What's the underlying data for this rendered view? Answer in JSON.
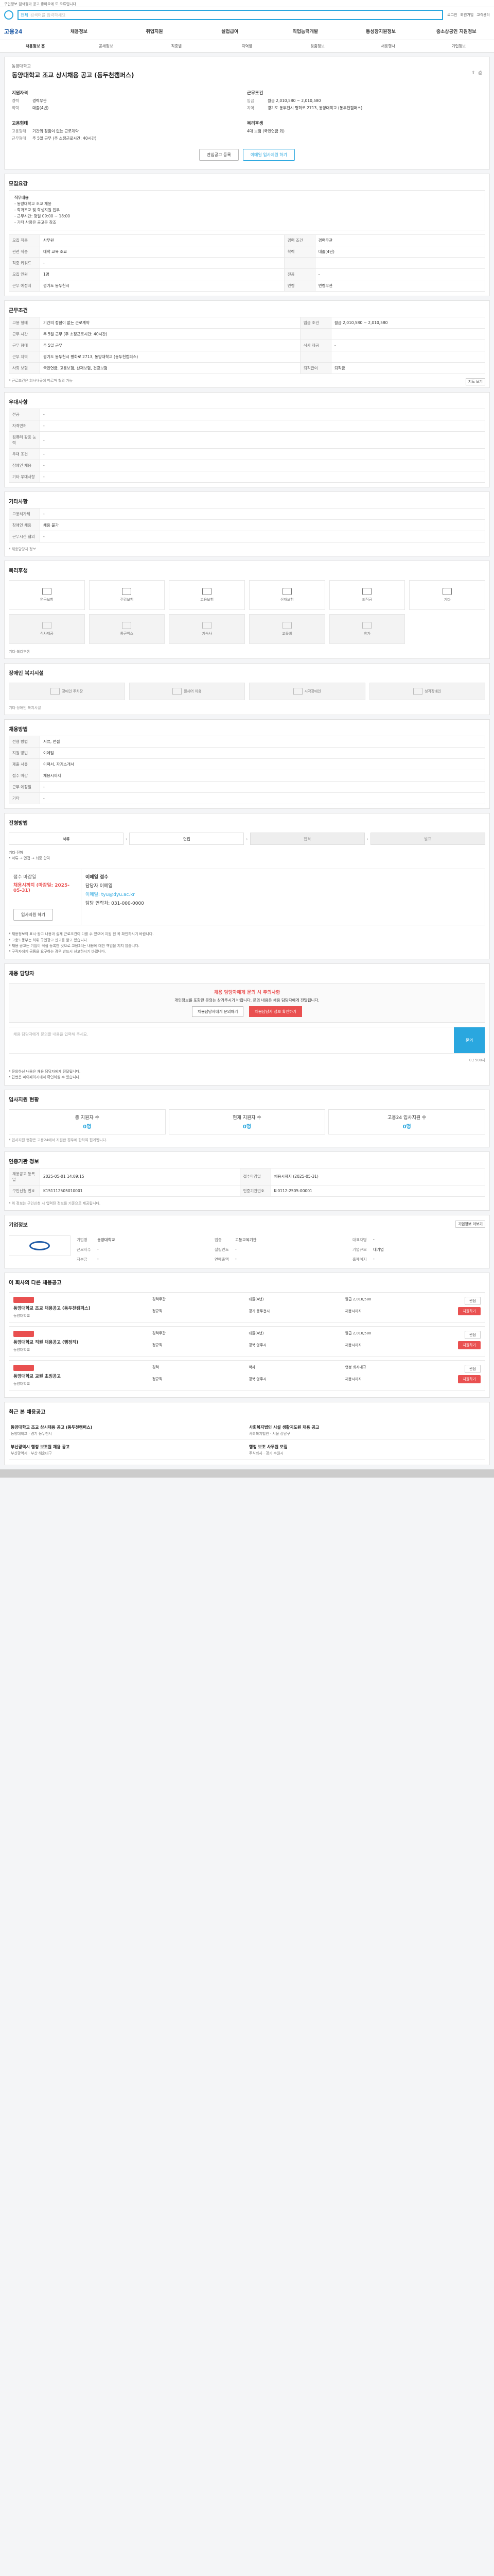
{
  "top_note": "구인정보 검색결과 공고 좋아요에 도 오류입니다",
  "search": {
    "scope": "전체",
    "placeholder": "검색어를 입력하세요"
  },
  "top_links": [
    "로그인",
    "회원가입",
    "고객센터"
  ],
  "brand": "고용24",
  "gnb": [
    "채용정보",
    "취업지원",
    "실업급여",
    "직업능력개발",
    "통성장지원정보",
    "중소상공인 지원정보"
  ],
  "lnb": [
    "채용정보 홈",
    "공채정보",
    "직종별",
    "지역별",
    "맞춤정보",
    "채용행사",
    "기업정보"
  ],
  "header": {
    "org": "동양대학교",
    "title": "동양대학교 조교 상시채용 공고 (동두천캠퍼스)",
    "icons": [
      "share-icon",
      "print-icon"
    ]
  },
  "summary": {
    "left_h": "지원자격",
    "left": [
      [
        "경력",
        "경력무관"
      ],
      [
        "학력",
        "대졸(4년)"
      ]
    ],
    "right_h": "근무조건",
    "right": [
      [
        "임금",
        "월급 2,010,580 ~ 2,010,580"
      ],
      [
        "지역",
        "경기도 동두천시 평화로 2713, 동양대학교 (동두천캠퍼스)"
      ]
    ],
    "left_h2": "고용형태",
    "left2": [
      [
        "고용형태",
        "기간의 정함이 없는 근로계약"
      ],
      [
        "근무형태",
        "주 5일 근무 (주 소정근로시간: 40시간)"
      ]
    ],
    "right_h2": "복리후생",
    "right2": [
      [
        "",
        "4대 보험 (국민연금 외)"
      ]
    ]
  },
  "btns": {
    "save": "관심공고 등록",
    "apply": "이메일 입사지원 하기"
  },
  "s_recruit": "모집요강",
  "guide": [
    "직무내용",
    "- 동양대학교 조교 채용",
    "- 학과조교 및 학생지원 업무",
    "- 근무시간: 평일 09:00 ~ 18:00",
    "- 기타 사항은 공고문 참조"
  ],
  "recruit_rows": [
    [
      "모집 직종",
      "사무원",
      "경력 조건",
      "경력무관"
    ],
    [
      "관련 직종",
      "대학 교육 조교",
      "학력",
      "대졸(4년)"
    ],
    [
      "직종 키워드",
      "-",
      "",
      ""
    ],
    [
      "모집 인원",
      "1명",
      "전공",
      "-"
    ],
    [
      "근무 예정지",
      "경기도 동두천시",
      "연령",
      "연령무관"
    ]
  ],
  "s_cond": "근무조건",
  "cond_rows": [
    [
      "고용 형태",
      "기간의 정함이 없는 근로계약",
      "임금 조건",
      "월급 2,010,580 ~ 2,010,580"
    ],
    [
      "근무 시간",
      "주 5일 근무 (주 소정근로시간: 40시간)",
      "",
      ""
    ],
    [
      "근무 형태",
      "주 5일 근무",
      "식사 제공",
      "-"
    ],
    [
      "근무 지역",
      "경기도 동두천시 평화로 2713, 동양대학교 (동두천캠퍼스)",
      "",
      ""
    ],
    [
      "사회 보험",
      "국민연금, 고용보험, 산재보험, 건강보험",
      "퇴직급여",
      "퇴직금"
    ]
  ],
  "cond_more": "지도 보기",
  "cond_note": "* 근로조건은 회사내규에 따르며 협의 가능",
  "s_pref": "우대사항",
  "pref_rows": [
    [
      "전공",
      "-"
    ],
    [
      "자격면허",
      "-"
    ],
    [
      "컴퓨터 활용 능력",
      "-"
    ],
    [
      "우대 조건",
      "-"
    ],
    [
      "장애인 채용",
      "-"
    ],
    [
      "기타 우대사항",
      "-"
    ]
  ],
  "s_etc": "기타사항",
  "etc_rows": [
    [
      "고용허가제",
      "-"
    ],
    [
      "장애인 채용",
      "채용 불가"
    ],
    [
      "근무시간 협의",
      "-"
    ]
  ],
  "etc_note": "* 채용담당자 정보",
  "s_welfare": "복리후생",
  "welfare_icons": [
    [
      "연금보험",
      "pension-icon"
    ],
    [
      "건강보험",
      "health-icon"
    ],
    [
      "고용보험",
      "employ-icon"
    ],
    [
      "산재보험",
      "accident-icon"
    ],
    [
      "퇴직금",
      "retire-icon"
    ],
    [
      "기타",
      "etc-icon"
    ],
    [
      "식사제공",
      "meal-icon"
    ],
    [
      "통근버스",
      "bus-icon"
    ],
    [
      "기숙사",
      "dorm-icon"
    ],
    [
      "교육비",
      "edu-icon"
    ],
    [
      "휴가",
      "vacation-icon"
    ]
  ],
  "welfare_note": "기타 복리후생",
  "s_dis": "장애인 복지시설",
  "dis_icons": [
    "장애인 주차장",
    "휠체어 이용",
    "시각장애인",
    "청각장애인"
  ],
  "dis_note": "기타 장애인 복지시설",
  "s_method": "채용방법",
  "method_rows": [
    [
      "전형 방법",
      "서류, 면접"
    ],
    [
      "지원 방법",
      "이메일"
    ],
    [
      "제출 서류",
      "이력서, 자기소개서"
    ],
    [
      "접수 마감",
      "채용시까지"
    ],
    [
      "근무 예정일",
      "-"
    ],
    [
      "기타",
      "-"
    ]
  ],
  "s_proc": "전형방법",
  "proc_steps": [
    "서류",
    "면접",
    "합격",
    "발표"
  ],
  "proc_note": "기타 전형",
  "proc_bul": "* 서류 → 면접 → 최종 합격",
  "apply": {
    "status": "접수 마감일",
    "deadline": "채용시까지 (마감일: 2025-05-31)",
    "method": "이메일 접수",
    "contact": "담당자 이메일",
    "email": "이메일: tyu@dyu.ac.kr",
    "tel": "담당 연락처: 031-000-0000",
    "btn": "입사지원 하기"
  },
  "apply_bul": [
    "* 채용정보의 표시·광고 내용과 실제 근로조건이 다를 수 있으며 지원 전 꼭 확인하시기 바랍니다.",
    "* 고용노동부는 허위 구인광고 신고를 받고 있습니다.",
    "* 채용 공고는 기업이 직접 등록한 것으로 고용24는 내용에 대한 책임을 지지 않습니다.",
    "* 구직자에게 금품을 요구하는 경우 반드시 신고하시기 바랍니다."
  ],
  "s_qna": "채용 담당자",
  "qna": {
    "title": "채용 담당자에게 문의 시 주의사항",
    "desc": "개인정보를 포함한 문의는 삼가주시기 바랍니다. 문의 내용은 채용 담당자에게 전달됩니다.",
    "b1": "채용담당자에게 문의하기",
    "b2": "채용담당자 정보 확인하기",
    "placeholder": "채용 담당자에게 문의할 내용을 입력해 주세요.",
    "send": "문의",
    "count": "0 / 500자"
  },
  "qna_bul": [
    "* 문의하신 내용은 채용 담당자에게 전달됩니다.",
    "* 답변은 마이페이지에서 확인하실 수 있습니다."
  ],
  "s_stat": "입사지원 현황",
  "stats": [
    [
      "총 지원자 수",
      "0명"
    ],
    [
      "현재 지원자 수",
      "0명"
    ],
    [
      "고용24 입사지원 수",
      "0명"
    ]
  ],
  "stat_note": "* 입사지원 현황은 고용24에서 지원한 경우에 한하여 집계됩니다.",
  "s_info": "인증기관 정보",
  "info_rows": [
    [
      "채용공고 등록일",
      "2025-05-01 14:09:15",
      "접수마감일",
      "채용시까지 (2025-05-31)"
    ],
    [
      "구인신청 번호",
      "K151112505010001",
      "인증기관번호",
      "K-0112-2505-00001"
    ]
  ],
  "info_note": "* 위 정보는 구인신청 시 입력된 정보를 기준으로 제공됩니다.",
  "s_firm": "기업정보",
  "firm_more": "기업정보 더보기",
  "firm": [
    [
      "기업명",
      "동양대학교"
    ],
    [
      "업종",
      "고등교육기관"
    ],
    [
      "대표자명",
      "-"
    ],
    [
      "근로자수",
      "-"
    ],
    [
      "설립연도",
      "-"
    ],
    [
      "기업규모",
      "대기업"
    ],
    [
      "자본금",
      "-"
    ],
    [
      "연매출액",
      "-"
    ],
    [
      "홈페이지",
      "-"
    ]
  ],
  "s_other": "이 회사의 다른 채용공고",
  "jobs": [
    {
      "badge": "채용시까지",
      "title": "동양대학교 조교 채용공고 (동두천캠퍼스)",
      "org": "동양대학교",
      "m": [
        "경력무관",
        "대졸(4년)",
        "월급 2,010,580",
        "정규직",
        "경기 동두천시",
        "채용시까지"
      ],
      "save": "관심",
      "go": "지원하기"
    },
    {
      "badge": "채용시까지",
      "title": "동양대학교 직원 채용공고 (행정직)",
      "org": "동양대학교",
      "m": [
        "경력무관",
        "대졸(4년)",
        "월급 2,010,580",
        "정규직",
        "경북 영주시",
        "채용시까지"
      ],
      "save": "관심",
      "go": "지원하기"
    },
    {
      "badge": "채용시까지",
      "title": "동양대학교 교원 초빙공고",
      "org": "동양대학교",
      "m": [
        "경력",
        "박사",
        "연봉 회사내규",
        "정규직",
        "경북 영주시",
        "채용시까지"
      ],
      "save": "관심",
      "go": "지원하기"
    }
  ],
  "s_recent": "최근 본 채용공고",
  "recent": [
    {
      "t": "동양대학교 조교 상시채용 공고 (동두천캠퍼스)",
      "m": "동양대학교 · 경기 동두천시"
    },
    {
      "t": "사회복지법인 시설 생활지도원 채용 공고",
      "m": "사회복지법인 · 서울 강남구"
    },
    {
      "t": "부산광역시 행정 보조원 채용 공고",
      "m": "부산광역시 · 부산 해운대구"
    },
    {
      "t": "행정 보조 사무원 모집",
      "m": "주식회사 · 경기 수원시"
    }
  ]
}
